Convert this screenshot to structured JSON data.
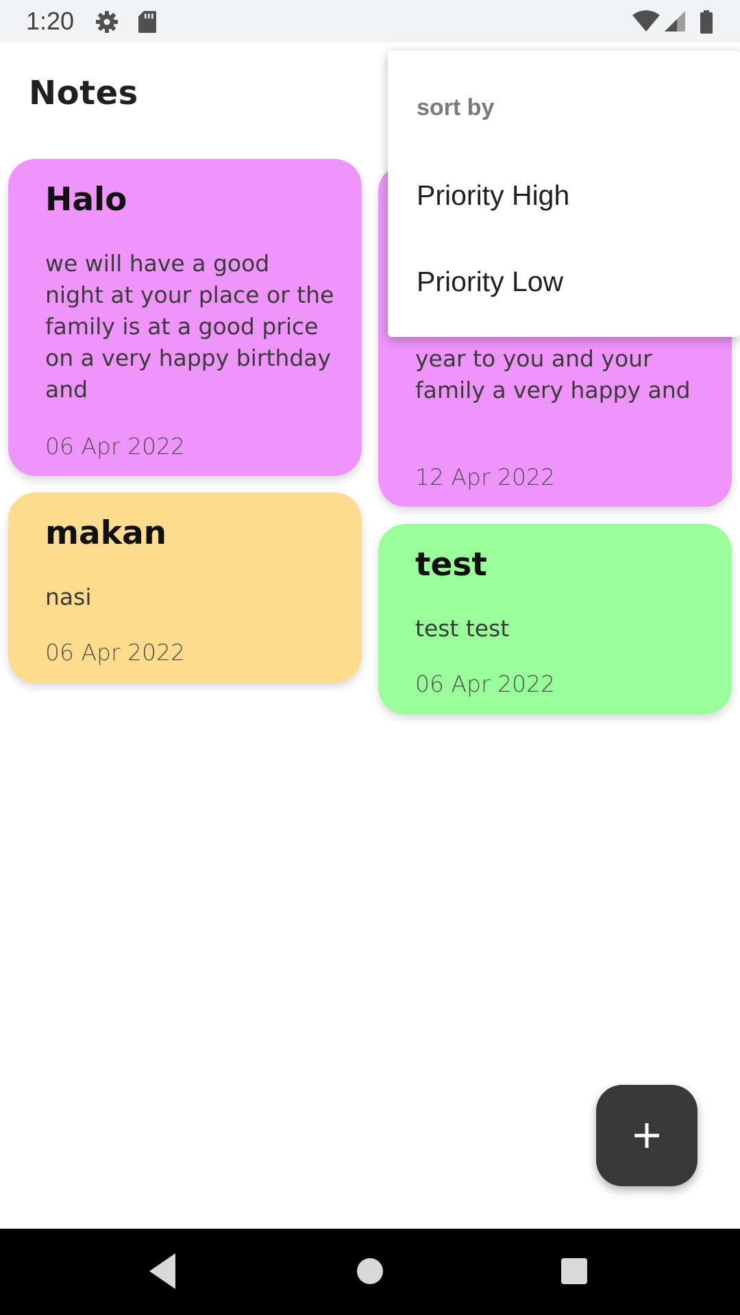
{
  "status_bar": {
    "time": "1:20",
    "icons": [
      "settings-icon",
      "sd-card-icon",
      "wifi-icon",
      "signal-icon",
      "battery-icon"
    ]
  },
  "header": {
    "title": "Notes"
  },
  "notes": [
    {
      "title": "Halo",
      "body": "we will have a good night at your place or the family is at a good price on a very happy birthday and",
      "date": "06 Apr 2022",
      "color": "#ef94fb"
    },
    {
      "title": "makan",
      "body": "nasi",
      "date": "06 Apr 2022",
      "color": "#fedc8d"
    },
    {
      "title": "",
      "body": "year to you and your family a very happy and",
      "date": "12 Apr 2022",
      "color": "#ef94fb"
    },
    {
      "title": "test",
      "body": "test test",
      "date": "06 Apr 2022",
      "color": "#99fd99"
    }
  ],
  "sort_menu": {
    "header": "sort by",
    "items": [
      "Priority High",
      "Priority Low"
    ]
  },
  "fab": {
    "icon": "plus-icon"
  },
  "nav_bar": {
    "icons": [
      "back-icon",
      "home-icon",
      "recents-icon"
    ]
  }
}
